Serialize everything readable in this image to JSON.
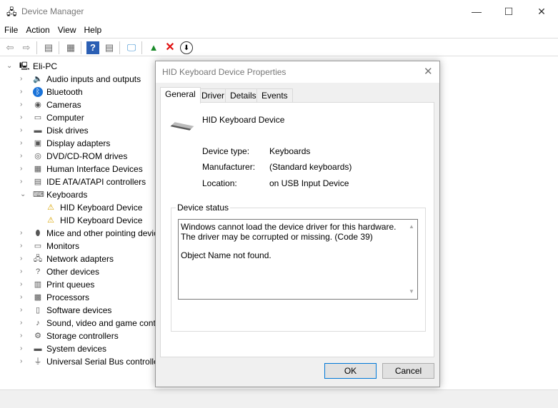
{
  "window": {
    "title": "Device Manager",
    "minimize": "—",
    "maximize": "☐",
    "close": "✕"
  },
  "menu": [
    "File",
    "Action",
    "View",
    "Help"
  ],
  "tree": {
    "root": "Eli-PC",
    "items": [
      {
        "label": "Audio inputs and outputs",
        "icon": "speaker-icon",
        "expanded": false
      },
      {
        "label": "Bluetooth",
        "icon": "bluetooth-icon",
        "expanded": false
      },
      {
        "label": "Cameras",
        "icon": "camera-icon",
        "expanded": false
      },
      {
        "label": "Computer",
        "icon": "computer-icon",
        "expanded": false
      },
      {
        "label": "Disk drives",
        "icon": "disk-icon",
        "expanded": false
      },
      {
        "label": "Display adapters",
        "icon": "display-icon",
        "expanded": false
      },
      {
        "label": "DVD/CD-ROM drives",
        "icon": "dvd-icon",
        "expanded": false
      },
      {
        "label": "Human Interface Devices",
        "icon": "hid-icon",
        "expanded": false
      },
      {
        "label": "IDE ATA/ATAPI controllers",
        "icon": "ide-icon",
        "expanded": false
      },
      {
        "label": "Keyboards",
        "icon": "keyboard-icon",
        "expanded": true
      },
      {
        "label": "HID Keyboard Device",
        "icon": "warning-keyboard-icon",
        "child": true
      },
      {
        "label": "HID Keyboard Device",
        "icon": "warning-keyboard-icon",
        "child": true
      },
      {
        "label": "Mice and other pointing devices",
        "icon": "mouse-icon",
        "expanded": false
      },
      {
        "label": "Monitors",
        "icon": "monitor-icon",
        "expanded": false
      },
      {
        "label": "Network adapters",
        "icon": "network-icon",
        "expanded": false
      },
      {
        "label": "Other devices",
        "icon": "other-icon",
        "expanded": false
      },
      {
        "label": "Print queues",
        "icon": "printer-icon",
        "expanded": false
      },
      {
        "label": "Processors",
        "icon": "processor-icon",
        "expanded": false
      },
      {
        "label": "Software devices",
        "icon": "software-icon",
        "expanded": false
      },
      {
        "label": "Sound, video and game controllers",
        "icon": "sound-icon",
        "expanded": false
      },
      {
        "label": "Storage controllers",
        "icon": "storage-icon",
        "expanded": false
      },
      {
        "label": "System devices",
        "icon": "system-icon",
        "expanded": false
      },
      {
        "label": "Universal Serial Bus controllers",
        "icon": "usb-icon",
        "expanded": false
      }
    ]
  },
  "dialog": {
    "title": "HID Keyboard Device Properties",
    "tabs": [
      "General",
      "Driver",
      "Details",
      "Events"
    ],
    "device_name": "HID Keyboard Device",
    "props": [
      {
        "label": "Device type:",
        "value": "Keyboards"
      },
      {
        "label": "Manufacturer:",
        "value": "(Standard keyboards)"
      },
      {
        "label": "Location:",
        "value": "on USB Input Device"
      }
    ],
    "status_title": "Device status",
    "status_line1": "Windows cannot load the device driver for this hardware. The driver may be corrupted or missing. (Code 39)",
    "status_line2": "Object Name not found.",
    "ok": "OK",
    "cancel": "Cancel"
  }
}
